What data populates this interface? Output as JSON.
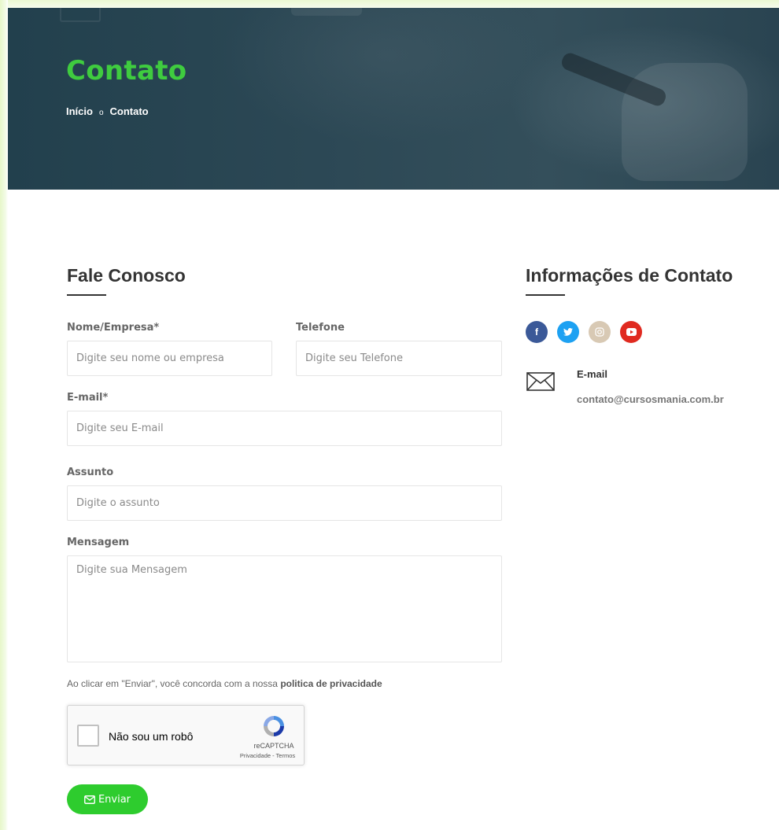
{
  "hero": {
    "title": "Contato",
    "breadcrumb": {
      "home": "Início",
      "separator": "o",
      "current": "Contato"
    }
  },
  "form_section": {
    "heading": "Fale Conosco",
    "fields": {
      "name": {
        "label": "Nome/Empresa*",
        "placeholder": "Digite seu nome ou empresa"
      },
      "phone": {
        "label": "Telefone",
        "placeholder": "Digite seu Telefone"
      },
      "email": {
        "label": "E-mail*",
        "placeholder": "Digite seu E-mail"
      },
      "subject": {
        "label": "Assunto",
        "placeholder": "Digite o assunto"
      },
      "message": {
        "label": "Mensagem",
        "placeholder": "Digite sua Mensagem"
      }
    },
    "consent": {
      "text": "Ao clicar em \"Enviar\", você concorda com a nossa ",
      "link": "politica de privacidade"
    },
    "captcha": {
      "label": "Não sou um robô",
      "brand": "reCAPTCHA",
      "links": "Privacidade - Termos"
    },
    "submit_label": "Enviar"
  },
  "info_section": {
    "heading": "Informações de Contato",
    "social": [
      {
        "name": "facebook",
        "glyph": "f",
        "color": "#3b5998"
      },
      {
        "name": "twitter",
        "glyph": "t",
        "color": "#1da1f2"
      },
      {
        "name": "instagram",
        "glyph": "◎",
        "color": "#d8c9b4"
      },
      {
        "name": "youtube",
        "glyph": "▶",
        "color": "#e02a20"
      }
    ],
    "email_title": "E-mail",
    "email_value": "contato@cursosmania.com.br"
  },
  "colors": {
    "accent": "#2ecc2e",
    "hero_title": "#3fcc3f",
    "hero_bg": "#2c4855"
  }
}
